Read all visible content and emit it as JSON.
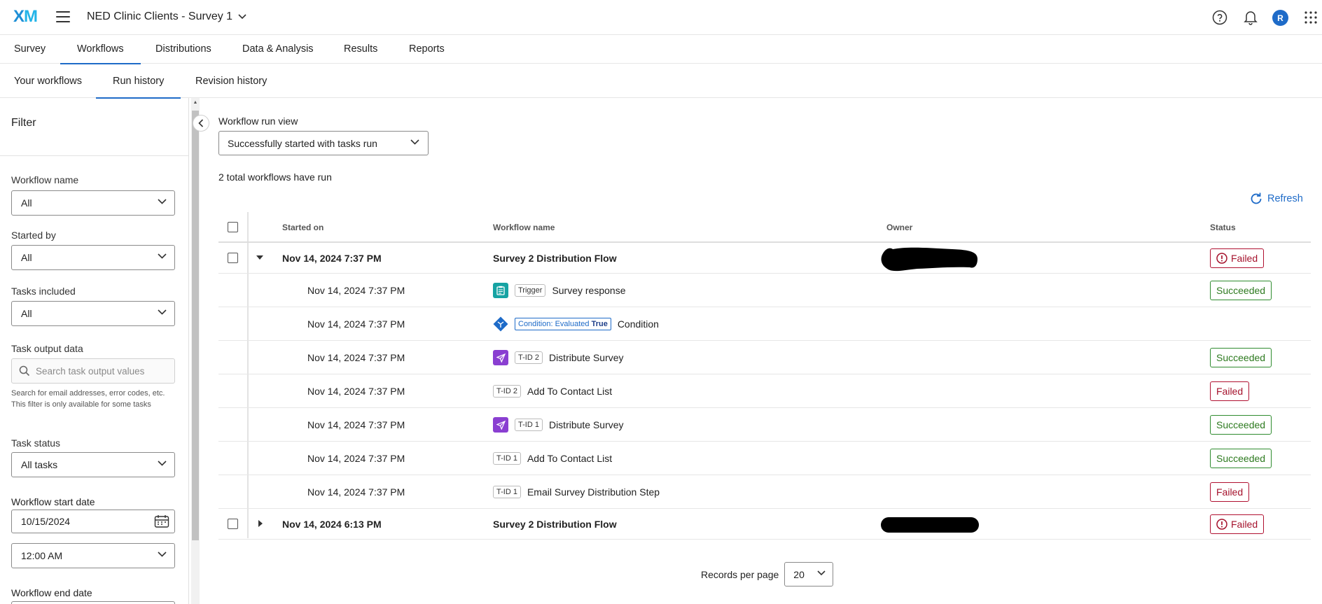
{
  "app": {
    "logo_text": "XM",
    "project_title": "NED Clinic Clients - Survey 1",
    "avatar_initial": "R",
    "accent_color": "#1e6bc8"
  },
  "nav": {
    "tabs": [
      "Survey",
      "Workflows",
      "Distributions",
      "Data & Analysis",
      "Results",
      "Reports"
    ],
    "active": "Workflows"
  },
  "subnav": {
    "tabs": [
      "Your workflows",
      "Run history",
      "Revision history"
    ],
    "active": "Run history"
  },
  "filter": {
    "title": "Filter",
    "workflow_name": {
      "label": "Workflow name",
      "value": "All"
    },
    "started_by": {
      "label": "Started by",
      "value": "All"
    },
    "tasks_included": {
      "label": "Tasks included",
      "value": "All"
    },
    "task_output": {
      "label": "Task output data",
      "placeholder": "Search task output values",
      "help_line1": "Search for email addresses, error codes, etc.",
      "help_line2": "This filter is only available for some tasks"
    },
    "task_status": {
      "label": "Task status",
      "value": "All tasks"
    },
    "start_date": {
      "label": "Workflow start date",
      "date": "10/15/2024",
      "time": "12:00 AM"
    },
    "end_date": {
      "label": "Workflow end date"
    }
  },
  "main": {
    "run_view_label": "Workflow run view",
    "run_view_value": "Successfully started with tasks run",
    "total_text": "2 total workflows have run",
    "refresh_label": "Refresh"
  },
  "table": {
    "headers": {
      "started_on": "Started on",
      "workflow_name": "Workflow name",
      "owner": "Owner",
      "status": "Status"
    },
    "runs": [
      {
        "started": "Nov 14, 2024 7:37 PM",
        "name": "Survey 2 Distribution Flow",
        "status": "Failed",
        "expanded": true,
        "tasks": [
          {
            "started": "Nov 14, 2024 7:37 PM",
            "icon": "clipboard-icon",
            "tag": "Trigger",
            "name": "Survey response",
            "status": "Succeeded"
          },
          {
            "started": "Nov 14, 2024 7:37 PM",
            "icon": "condition-icon",
            "tag_prefix": "Condition: Evaluated",
            "tag_value": "True",
            "name": "Condition",
            "status": ""
          },
          {
            "started": "Nov 14, 2024 7:37 PM",
            "icon": "send-icon",
            "tag": "T-ID 2",
            "name": "Distribute Survey",
            "status": "Succeeded"
          },
          {
            "started": "Nov 14, 2024 7:37 PM",
            "icon": "",
            "tag": "T-ID 2",
            "name": "Add To Contact List",
            "status": "Failed"
          },
          {
            "started": "Nov 14, 2024 7:37 PM",
            "icon": "send-icon",
            "tag": "T-ID 1",
            "name": "Distribute Survey",
            "status": "Succeeded"
          },
          {
            "started": "Nov 14, 2024 7:37 PM",
            "icon": "",
            "tag": "T-ID 1",
            "name": "Add To Contact List",
            "status": "Succeeded"
          },
          {
            "started": "Nov 14, 2024 7:37 PM",
            "icon": "",
            "tag": "T-ID 1",
            "name": "Email Survey Distribution Step",
            "status": "Failed"
          }
        ]
      },
      {
        "started": "Nov 14, 2024 6:13 PM",
        "name": "Survey 2 Distribution Flow",
        "status": "Failed",
        "expanded": false
      }
    ]
  },
  "pager": {
    "label": "Records per page",
    "value": "20"
  }
}
